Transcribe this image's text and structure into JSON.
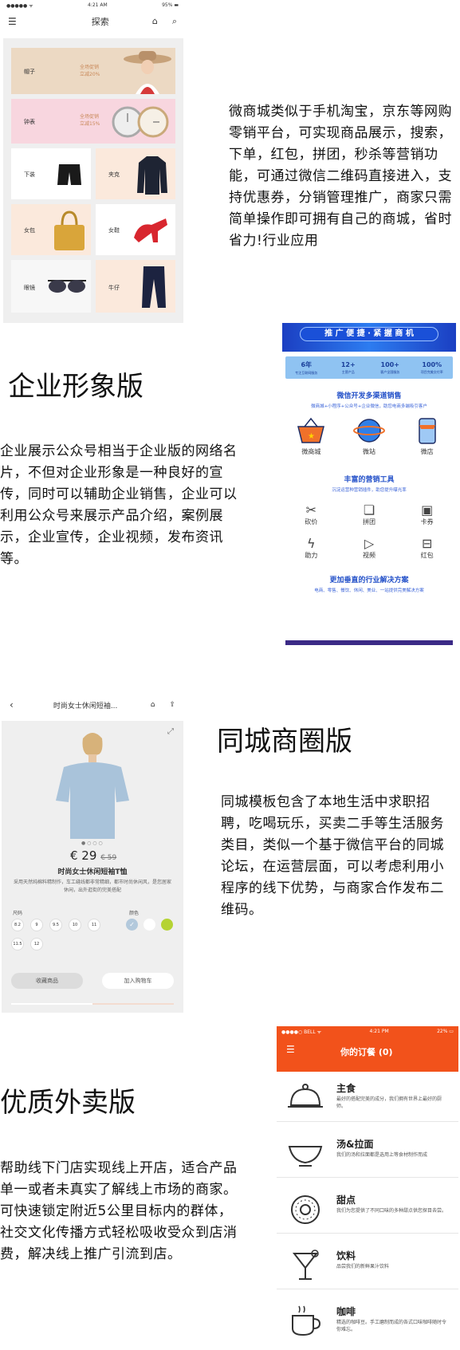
{
  "section1": {
    "phone": {
      "status_left": "●●●●● ᯤ",
      "status_time": "4:21 AM",
      "status_right": "95% ▬",
      "nav_title": "探索",
      "tiles": [
        {
          "label": "帽子",
          "promo1": "全场促销",
          "promo2": "立减20%"
        },
        {
          "label": "钟表",
          "promo1": "全场促销",
          "promo2": "立减15%"
        },
        {
          "label": "下装"
        },
        {
          "label": "夹克"
        },
        {
          "label": "女包"
        },
        {
          "label": "女鞋"
        },
        {
          "label": "眼镜"
        },
        {
          "label": "牛仔"
        }
      ]
    },
    "description": "微商城类似于手机淘宝，京东等网购零销平台，可实现商品展示，搜索，下单，红包，拼团，秒杀等营销功能，可通过微信二维码直接进入，支持优惠券，分销管理推广，商家只需简单操作即可拥有自己的商城，省时省力!行业应用"
  },
  "section2": {
    "title": "企业形象版",
    "description": "企业展示公众号相当于企业版的网络名片，不但对企业形象是一种良好的宣传，同时可以辅助企业销售，企业可以利用公众号来展示产品介绍，案例展示，企业宣传，企业视频，发布资讯等。",
    "phone": {
      "banner": "推 广 便 捷 · 紧 握 商 机",
      "stats": [
        {
          "value": "6年",
          "label": "专注互联网服务"
        },
        {
          "value": "12+",
          "label": "主营产品"
        },
        {
          "value": "100+",
          "label": "客户全国服务"
        },
        {
          "value": "100%",
          "label": "项目完美交付率"
        }
      ],
      "channels_title": "微信开发多渠道销售",
      "channels_sub": "微商城+小程序+公众号+企业微信，助您电商多端吸引客户",
      "channels": [
        "微商城",
        "微站",
        "微店"
      ],
      "tools_title": "丰富的营销工具",
      "tools_sub": "沉淀运营种营销插件，助您提升曝光率",
      "tools": [
        "砍价",
        "拼团",
        "卡券",
        "助力",
        "视频",
        "红包"
      ],
      "solutions_title": "更加垂直的行业解决方案",
      "solutions_sub": "电商、零售、餐饮、休闲、美业、一站提供完美解决方案"
    }
  },
  "section3": {
    "title": "同城商圈版",
    "description": "同城模板包含了本地生活中求职招聘，吃喝玩乐，买卖二手等生活服务类目，类似一个基于微信平台的同城论坛，在运营层面，可以考虑利用小程序的线下优势，与商家合作发布二维码。",
    "phone": {
      "nav_title": "时尚女士休闲短袖...",
      "price": "€ 29",
      "old_price": "€ 59",
      "product_name": "时尚女士休闲短袖T恤",
      "product_desc": "采用天然纯棉料精制作，车工缝线都非常精细，都市时尚休闲风，是您居家休闲，出外逛街的完美搭配",
      "size_label": "尺码",
      "sizes": [
        "8.2",
        "9",
        "9.5",
        "10",
        "11",
        "11.5",
        "12"
      ],
      "color_label": "颜色",
      "fav_button": "收藏商品",
      "cart_button": "加入购物车"
    }
  },
  "section4": {
    "title": "优质外卖版",
    "description": "帮助线下门店实现线上开店，适合产品单一或者未真实了解线上市场的商家。可快速锁定附近5公里目标内的群体，社交文化传播方式轻松吸收受众到店消费，解决线上推广引流到店。",
    "phone": {
      "status_left": "●●●●○ BELL ᯤ",
      "status_time": "4:21 PM",
      "status_right": "22% ▭",
      "header_title": "你的订餐 (0)",
      "items": [
        {
          "name": "主食",
          "desc": "最好的搭配完美的成分，我们拥有世界上最好的厨师。"
        },
        {
          "name": "汤&拉面",
          "desc": "我们的汤和拉面都是选用上等食材制作而成"
        },
        {
          "name": "甜点",
          "desc": "我们为您提供了不同口味的多种甜点供您探目去尝。"
        },
        {
          "name": "饮料",
          "desc": "品尝我们的新鲜果汁饮料"
        },
        {
          "name": "咖啡",
          "desc": "精选的咖啡豆。手工磨制而成的各式口味咖啡随时令你难忘。"
        }
      ],
      "accent": "#f2521b"
    }
  }
}
